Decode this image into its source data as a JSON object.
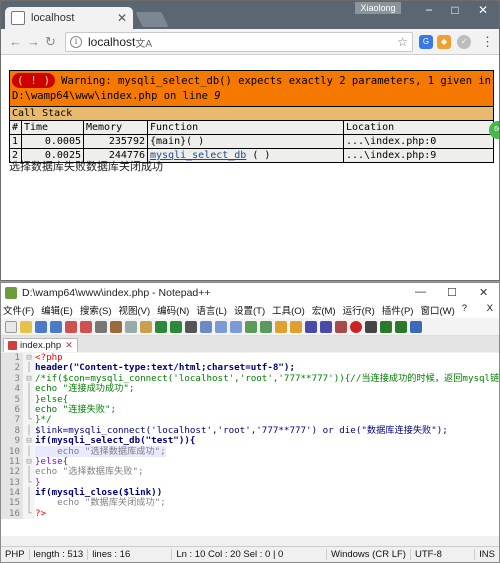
{
  "chrome": {
    "tab_title": "localhost",
    "user": "Xiaolong",
    "url": "localhost",
    "window_controls": [
      "−",
      "□",
      "✕"
    ]
  },
  "xdebug": {
    "bang": "( ! )",
    "warning": "Warning: mysqli_select_db() expects exactly 2 parameters, 1 given in D:\\wamp64\\www\\index.php on line ",
    "line": "9",
    "call_stack": "Call Stack",
    "headers": [
      "#",
      "Time",
      "Memory",
      "Function",
      "Location"
    ],
    "rows": [
      {
        "n": "1",
        "time": "0.0005",
        "memory": "235792",
        "func": "{main}( )",
        "func_link": "",
        "func_args": "",
        "location": "...\\index.php:0"
      },
      {
        "n": "2",
        "time": "0.0025",
        "memory": "244776",
        "func": "",
        "func_link": "mysqli_select_db",
        "func_args": " ( )",
        "location": "...\\index.php:9"
      }
    ],
    "output": "选择数据库失败数据库关闭成功"
  },
  "npp": {
    "title": "D:\\wamp64\\www\\index.php - Notepad++",
    "menus": [
      "文件(F)",
      "编辑(E)",
      "搜索(S)",
      "视图(V)",
      "编码(N)",
      "语言(L)",
      "设置(T)",
      "工具(O)",
      "宏(M)",
      "运行(R)",
      "插件(P)",
      "窗口(W)",
      "?"
    ],
    "close_x": "X",
    "file_tab": "index.php",
    "lines": [
      "<?php",
      "header(\"Content-type:text/html;charset=utf-8\");",
      "/*if($con=mysqli_connect('localhost','root','777**777')){//当连接成功的时候，返回mysql链",
      "echo \"连接成功成功\";",
      "}else{",
      "echo \"连接失败\";",
      "}*/",
      "$link=mysqli_connect('localhost','root','777**777') or die(\"数据库连接失败\");",
      "if(mysqli_select_db(\"test\")){",
      "    echo \"选择数据库成功\";",
      "}else{",
      "echo \"选择数据库失败\";",
      "}",
      "if(mysqli_close($link))",
      "    echo \"数据库关闭成功\";",
      "?>"
    ],
    "status": {
      "type": "PHP",
      "length": "length : 513",
      "lines": "lines : 16",
      "pos": "Ln : 10   Col : 20   Sel : 0 | 0",
      "eol": "Windows (CR LF)",
      "enc": "UTF-8",
      "mode": "INS"
    }
  },
  "colors": {
    "xdebug_error_bg": "#f57900",
    "xdebug_callstack_bg": "#e9b96e",
    "chrome_frame": "#5a6672"
  }
}
